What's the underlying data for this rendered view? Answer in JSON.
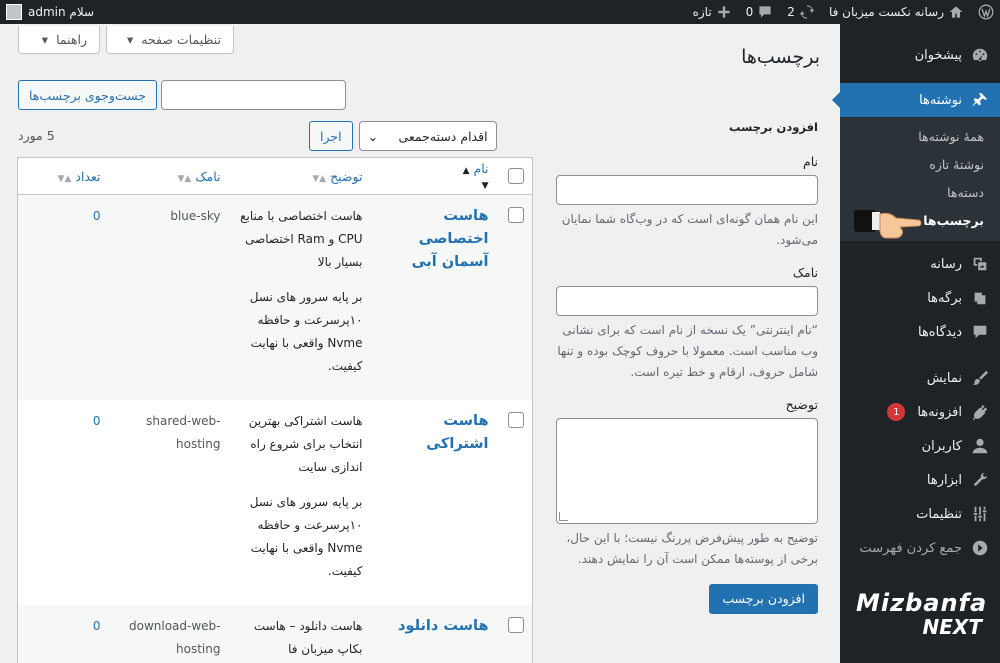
{
  "adminbar": {
    "site_name": "رسانه نکست میزبان فا",
    "updates": "2",
    "comments": "0",
    "new_label": "تازه",
    "greeting": "سلام admin"
  },
  "sidebar": {
    "dashboard": "پیشخوان",
    "posts": "نوشته‌ها",
    "submenu": [
      "همهٔ نوشته‌ها",
      "نوشتهٔ تازه",
      "دسته‌ها",
      "برچسب‌ها"
    ],
    "media": "رسانه",
    "pages": "برگه‌ها",
    "comments": "دیدگاه‌ها",
    "appearance": "نمایش",
    "plugins": "افزونه‌ها",
    "plugins_badge": "1",
    "users": "کاربران",
    "tools": "ابزارها",
    "settings": "تنظیمات",
    "collapse": "جمع کردن فهرست",
    "logo_line1": "Mizbanfa",
    "logo_line2": "NEXT"
  },
  "screen_meta": {
    "screen_options": "تنظیمات صفحه",
    "help": "راهنما"
  },
  "page": {
    "title": "برچسب‌ها"
  },
  "form": {
    "heading": "افزودن برچسب",
    "name_label": "نام",
    "name_desc": "این نام همان گونه‌ای است که در وب‌گاه شما نمایان می‌شود.",
    "slug_label": "نامک",
    "slug_desc": "“نام اینترنتی” یک نسخه از نام است که برای نشانی وب مناسب است. معمولا با حروف کوچک بوده و تنها شامل حروف، ارقام و خط تیره است.",
    "description_label": "توضیح",
    "description_desc": "توضیح به طور پیش‌فرض پررنگ نیست؛ با این حال، برخی از پوسته‌ها ممکن است آن را نمایش دهند.",
    "submit": "افزودن برچسب"
  },
  "list": {
    "search_button": "جست‌وجوی برچسب‌ها",
    "bulk_action": "اقدام دسته‌جمعی",
    "apply": "اجرا",
    "count": "5 مورد",
    "columns": {
      "name": "نام",
      "description": "توضیح",
      "slug": "نامک",
      "count": "تعداد"
    },
    "rows": [
      {
        "name": "هاست اختصاصی آسمان آبی",
        "desc1": "هاست اختصاصی با منابع CPU و Ram اختصاصی بسیار بالا",
        "desc2": "بر پایه سرور های نسل ۱۰پرسرعت و حافظه Nvme واقعی با نهایت کیفیت.",
        "slug": "blue-sky",
        "count": "0"
      },
      {
        "name": "هاست اشتراکی",
        "desc1": "هاست اشتراکی بهترین انتخاب برای شروع راه اندازی سایت",
        "desc2": "بر پایه سرور های نسل ۱۰پرسرعت و حافظه Nvme واقعی با نهایت کیفیت.",
        "slug": "shared-web-hosting",
        "count": "0"
      },
      {
        "name": "هاست دانلود",
        "desc1": "هاست دانلود – هاست بکاپ میزبان فا",
        "desc2": "",
        "slug": "download-web-hosting",
        "count": "0"
      }
    ]
  },
  "colors": {
    "accent": "#2271b1",
    "sidebar_bg": "#1d2327",
    "badge": "#d63638"
  }
}
